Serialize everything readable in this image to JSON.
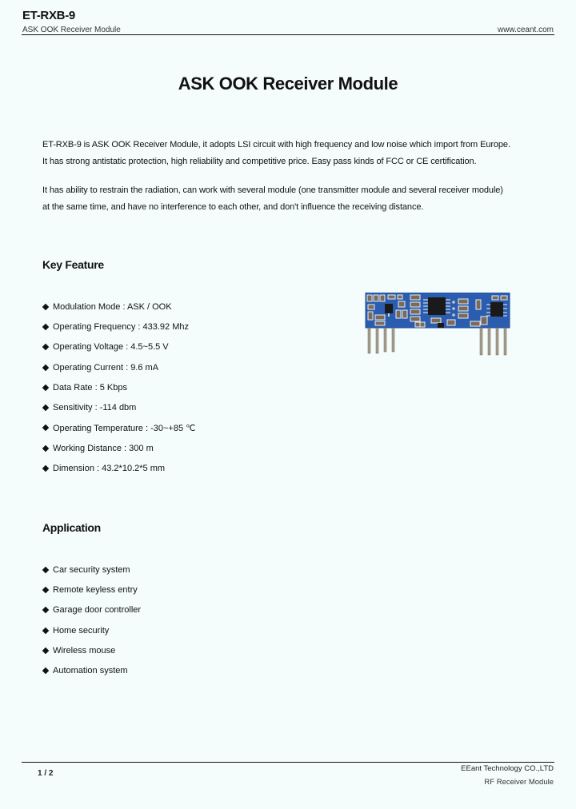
{
  "header": {
    "title": "ET-RXB-9",
    "subtitle": "ASK OOK Receiver Module",
    "website": "www.ceant.com"
  },
  "document": {
    "title": "ASK OOK Receiver Module",
    "intro": [
      {
        "line1": "ET-RXB-9 is ASK OOK Receiver Module, it adopts LSI circuit with high frequency and low noise which import from Europe.",
        "line2": "It has strong antistatic protection, high reliability and competitive price. Easy pass kinds of FCC or CE certification."
      },
      {
        "line1": "It has ability to restrain the radiation, can work with several module (one transmitter module and several receiver  module)",
        "line2": "at the same time, and have no interference to each other, and don't influence the receiving distance."
      }
    ],
    "key_feature": {
      "heading": "Key Feature",
      "bullet_icon": "diamond-bullet-icon",
      "items": [
        "Modulation Mode : ASK / OOK",
        "Operating Frequency : 433.92 Mhz",
        "Operating Voltage : 4.5~5.5 V",
        "Operating Current : 9.6 mA",
        "Data Rate : 5 Kbps",
        "Sensitivity : -114 dbm",
        "Operating Temperature : -30~+85 ℃",
        "Working Distance : 300 m",
        "Dimension : 43.2*10.2*5 mm"
      ]
    },
    "product_image": {
      "description": "Blue PCB receiver module with SMD components and two rows of 4 header pins",
      "colors": {
        "pcb": "#2a5db0",
        "silkscreen": "#e8eef8",
        "chip": "#1a1a1a",
        "pins": "#b8b0a0"
      }
    },
    "application": {
      "heading": "Application",
      "items": [
        "Car security system",
        "Remote keyless entry",
        "Garage door controller",
        "Home security",
        "Wireless mouse",
        "Automation system"
      ]
    }
  },
  "footer": {
    "page": "1 / 2",
    "company": "EEant Technology CO.,LTD",
    "product": "RF Receiver Module"
  }
}
